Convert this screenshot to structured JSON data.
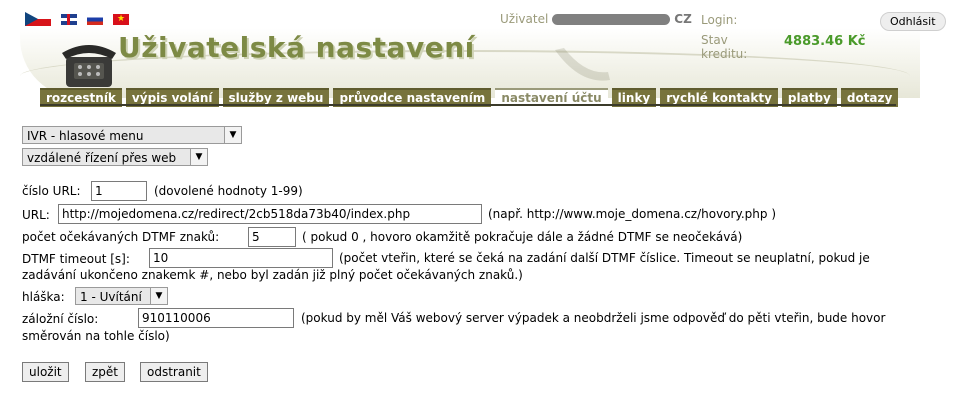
{
  "flags": [
    "cz-flag-icon",
    "uk-flag-icon",
    "ru-flag-icon",
    "vn-flag-icon"
  ],
  "header": {
    "title": "Uživatelská nastavení",
    "user_label": "Uživatel",
    "country": "CZ",
    "login_label": "Login:",
    "credit_label": "Stav kreditu:",
    "credit_value": "4883.46 Kč",
    "logout": "Odhlásit"
  },
  "nav": {
    "tabs": [
      {
        "label": "rozcestník"
      },
      {
        "label": "výpis volání"
      },
      {
        "label": "služby z webu"
      },
      {
        "label": "průvodce nastavením"
      },
      {
        "label": "nastavení účtu",
        "active": true
      },
      {
        "label": "linky"
      },
      {
        "label": "rychlé kontakty"
      },
      {
        "label": "platby"
      },
      {
        "label": "dotazy"
      }
    ]
  },
  "form": {
    "select_ivr": "IVR - hlasové menu",
    "select_remote": "vzdálené řízení přes web",
    "url_number_label": "číslo URL:",
    "url_number_value": "1",
    "url_number_note": "(dovolené hodnoty 1-99)",
    "url_label": "URL:",
    "url_value": "http://mojedomena.cz/redirect/2cb518da73b40/index.php",
    "url_note": "(např. http://www.moje_domena.cz/hovory.php )",
    "dtmf_count_label": "počet očekávaných DTMF znaků:",
    "dtmf_count_value": "5",
    "dtmf_count_note": "( pokud 0 , hovoro okamžitě pokračuje dále a žádné DTMF se neočekává)",
    "dtmf_timeout_label": "DTMF timeout [s]:",
    "dtmf_timeout_value": "10",
    "dtmf_timeout_note_1": "(počet vteřin, které se čeká na zadání další DTMF číslice. Timeout se neuplatní, pokud je",
    "dtmf_timeout_note_2": "zadávání ukončeno znakemk #, nebo byl zadán již plný počet očekávaných znaků.)",
    "message_label": "hláška:",
    "message_value": "1 - Uvítání",
    "backup_label": "záložní číslo:",
    "backup_value": "910110006",
    "backup_note_1": "(pokud by měl Váš webový server výpadek a neobdrželi jsme odpověď do pěti vteřin, bude hovor",
    "backup_note_2": "směrován na tohle číslo)",
    "save": "uložit",
    "back": "zpět",
    "remove": "odstranit"
  }
}
